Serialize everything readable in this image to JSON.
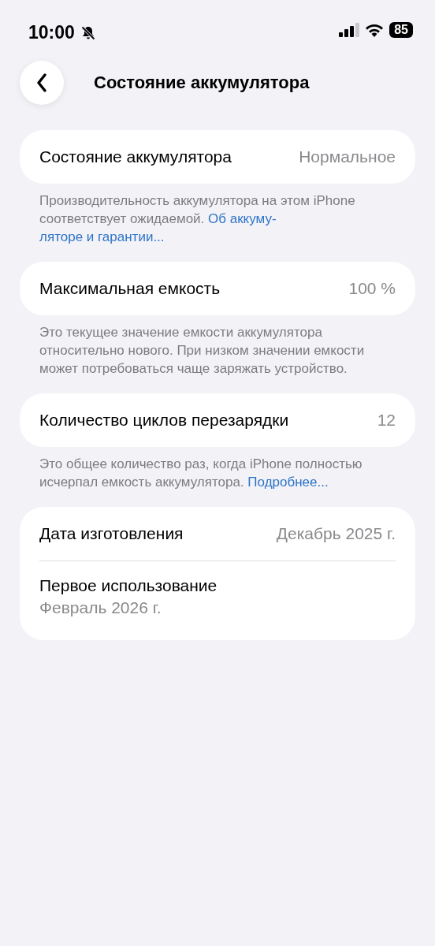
{
  "status_bar": {
    "time": "10:00",
    "silent": true,
    "battery": "85"
  },
  "nav": {
    "title": "Состояние аккумулятора"
  },
  "groups": [
    {
      "rows": [
        {
          "kind": "inline",
          "label": "Состояние аккумулятора",
          "value": "Нормальное"
        }
      ],
      "footer": {
        "text": "Производительность аккумулятора на этом iPhone соответствует ожидаемой.",
        "links": [
          "Об аккуму-",
          "ляторе и гарантии..."
        ]
      }
    },
    {
      "rows": [
        {
          "kind": "inline",
          "label": "Максимальная емкость",
          "value": "100 %"
        }
      ],
      "footer": {
        "text": "Это текущее значение емкости аккумулятора относительно нового. При низком значении емкости может потребоваться чаще заряжать устройство."
      }
    },
    {
      "rows": [
        {
          "kind": "inline",
          "label": "Количество циклов перезарядки",
          "value": "12"
        }
      ],
      "footer": {
        "text": "Это общее количество раз, когда iPhone полностью исчерпал емкость аккумулятора.",
        "links": [
          "Подробнее..."
        ]
      }
    },
    {
      "rows": [
        {
          "kind": "inline",
          "label": "Дата изготовления",
          "value": "Декабрь 2025 г."
        },
        {
          "kind": "stacked",
          "label": "Первое использование",
          "value": "Февраль 2026 г."
        }
      ]
    }
  ]
}
